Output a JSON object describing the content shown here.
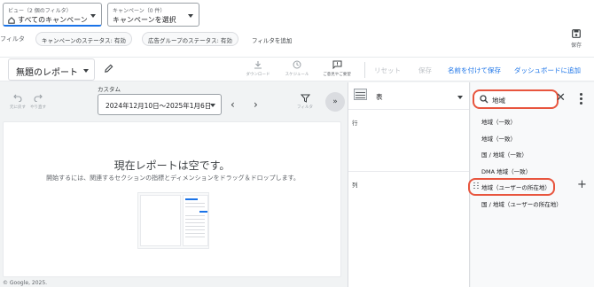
{
  "filters": {
    "view_label": "ビュー（2 個のフィルタ）",
    "view_value": "すべてのキャンペーン",
    "campaign_label": "キャンペーン（0 件）",
    "campaign_value": "キャンペーンを選択",
    "filter_label": "フィルタ",
    "chips": [
      "キャンペーンのステータス: 有効",
      "広告グループのステータス: 有効"
    ],
    "add_filter": "フィルタを追加",
    "save_label": "保存"
  },
  "toolbar": {
    "report_name": "無題のレポート",
    "download_label": "ダウンロード",
    "schedule_label": "スケジュール",
    "comment_label": "ご意見やご要望",
    "reset": "リセット",
    "save": "保存",
    "save_as": "名前を付けて保存",
    "add_dashboard": "ダッシュボードに追加",
    "accent_color": "#1a73e8"
  },
  "editor": {
    "undo_label": "元に戻す",
    "redo_label": "やり直す",
    "custom_label": "カスタム",
    "date_range": "2024年12月10日～2025年1月6日",
    "filter_label": "フィルタ",
    "empty_title": "現在レポートは空です。",
    "empty_desc": "開始するには、関連するセクションの指標とディメンションをドラッグ＆ドロップします。",
    "footer": "© Google, 2025."
  },
  "settings": {
    "viz_type": "表",
    "rows_label": "行",
    "columns_label": "列"
  },
  "dimensions": {
    "search_value": "地域",
    "items": [
      "地域（一致）",
      "地域（一致）",
      "国 / 地域（一致）",
      "DMA 地域（一致）",
      "地域（ユーザーの所在地）",
      "国 / 地域（ユーザーの所在地）"
    ],
    "highlight_color": "#e8553e"
  }
}
